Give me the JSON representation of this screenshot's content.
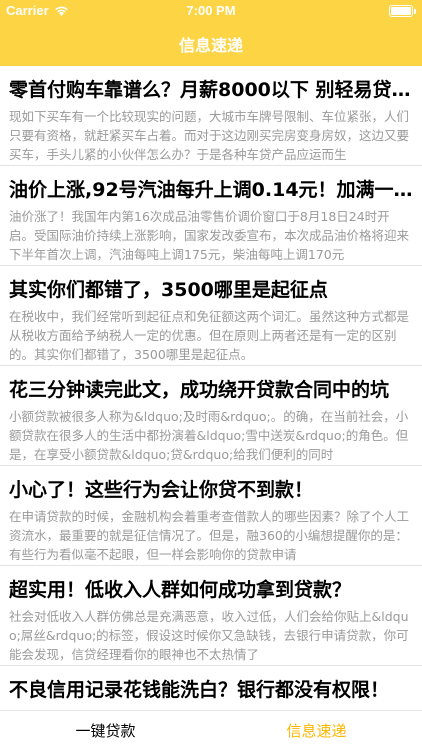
{
  "status_bar": {
    "carrier": "Carrier",
    "time": "7:00 PM",
    "icons": [
      "wifi-icon",
      "battery-icon"
    ]
  },
  "nav": {
    "title": "信息速递"
  },
  "colors": {
    "brand": "#FCD444",
    "active_tab": "#FCB800"
  },
  "news": [
    {
      "title": "零首付购车靠谱么？月薪8000以下 别轻易贷款买车",
      "summary": "现如下买车有一个比较现实的问题，大城市车牌号限制、车位紧张，人们只要有资格，就赶紧买车占着。而对于这边刚买完房变身房奴，这边又要买车，手头儿紧的小伙伴怎么办？于是各种车贷产品应运而生"
    },
    {
      "title": "油价上涨,92号汽油每升上调0.14元！加满一箱多花7元",
      "summary": "油价涨了！我国年内第16次成品油零售价调价窗口于8月18日24时开启。受国际油价持续上涨影响，国家发改委宣布，本次成品油价格将迎来下半年首次上调，汽油每吨上调175元，柴油每吨上调170元"
    },
    {
      "title": "其实你们都错了，3500哪里是起征点",
      "summary": "在税收中，我们经常听到起征点和免征额这两个词汇。虽然这种方式都是从税收方面给予纳税人一定的优惠。但在原则上两者还是有一定的区别的。其实你们都错了，3500哪里是起征点。"
    },
    {
      "title": "花三分钟读完此文，成功绕开贷款合同中的坑",
      "summary": "小额贷款被很多人称为&ldquo;及时雨&rdquo;。的确，在当前社会，小额贷款在很多人的生活中都扮演着&ldquo;雪中送炭&rdquo;的角色。但是，在享受小额贷款&ldquo;贷&rdquo;给我们便利的同时"
    },
    {
      "title": "小心了！这些行为会让你贷不到款！",
      "summary": "在申请贷款的时候，金融机构会着重考查借款人的哪些因素？除了个人工资流水，最重要的就是征信情况了。但是，融360的小编想提醒你的是：有些行为看似毫不起眼，但一样会影响你的贷款申请"
    },
    {
      "title": "超实用！低收入人群如何成功拿到贷款？",
      "summary": "社会对低收入人群仿佛总是充满恶意，收入过低，人们会给你贴上&ldquo;屌丝&rdquo;的标签，假设这时候你又急缺钱，去银行申请贷款，你可能会发现，信贷经理看你的眼神也不太热情了"
    },
    {
      "title": "不良信用记录花钱能洗白？银行都没有权限！",
      "summary": ""
    }
  ],
  "tabs": [
    {
      "label": "一键贷款",
      "active": false
    },
    {
      "label": "信息速递",
      "active": true
    }
  ]
}
